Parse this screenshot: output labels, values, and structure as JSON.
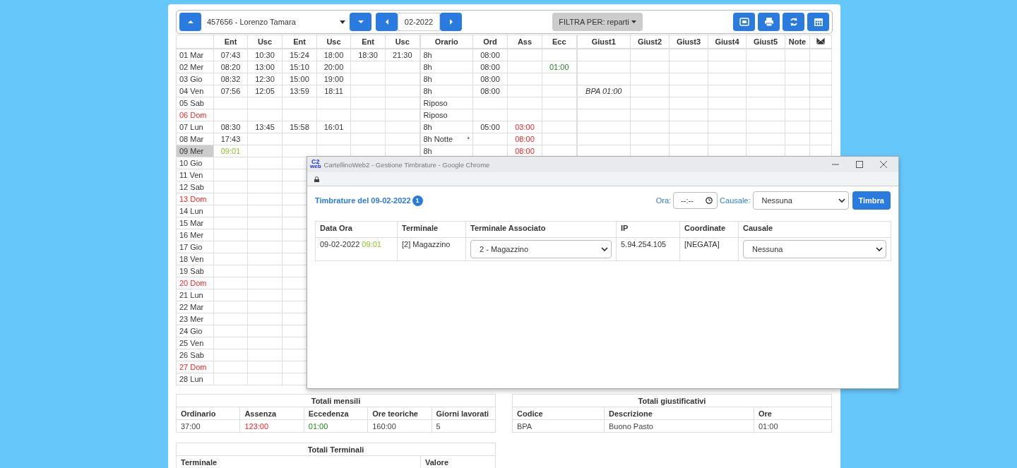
{
  "toolbar": {
    "employee": "457656 - Lorenzo Tamara",
    "period": "02-2022",
    "filter": "FILTRA PER: reparti"
  },
  "timesheet": {
    "columns": [
      "Ent",
      "Usc",
      "Ent",
      "Usc",
      "Ent",
      "Usc",
      "Orario",
      "Ord",
      "Ass",
      "Ecc",
      "Giust1",
      "Giust2",
      "Giust3",
      "Giust4",
      "Giust5",
      "Note"
    ],
    "rows": [
      {
        "day": "01 Mar",
        "holiday": false,
        "selected": false,
        "ent1": "07:43",
        "usc1": "10:30",
        "ent2": "15:24",
        "usc2": "18:00",
        "ent3": "18:30",
        "usc3": "21:30",
        "orario": "8h",
        "ord": "08:00"
      },
      {
        "day": "02 Mer",
        "holiday": false,
        "selected": false,
        "ent1": "08:20",
        "usc1": "13:00",
        "ent2": "15:10",
        "usc2": "20:00",
        "orario": "8h",
        "ord": "08:00",
        "ecc": "01:00"
      },
      {
        "day": "03 Gio",
        "holiday": false,
        "selected": false,
        "ent1": "08:32",
        "usc1": "12:30",
        "ent2": "15:00",
        "usc2": "19:00",
        "orario": "8h",
        "ord": "08:00"
      },
      {
        "day": "04 Ven",
        "holiday": false,
        "selected": false,
        "ent1": "07:56",
        "usc1": "12:05",
        "ent2": "13:59",
        "usc2": "18:11",
        "orario": "8h",
        "ord": "08:00",
        "giust1": "BPA 01:00"
      },
      {
        "day": "05 Sab",
        "holiday": false,
        "selected": false,
        "orario": "Riposo"
      },
      {
        "day": "06 Dom",
        "holiday": true,
        "selected": false,
        "orario": "Riposo"
      },
      {
        "day": "07 Lun",
        "holiday": false,
        "selected": false,
        "ent1": "08:30",
        "usc1": "13:45",
        "ent2": "15:58",
        "usc2": "16:01",
        "orario": "8h",
        "ord": "05:00",
        "ass": "03:00"
      },
      {
        "day": "08 Mar",
        "holiday": false,
        "selected": false,
        "ent1": "17:43",
        "orario": "8h Notte",
        "orario_flag": "*",
        "ass": "08:00"
      },
      {
        "day": "09 Mer",
        "holiday": false,
        "selected": true,
        "open_entry": true,
        "ent1": "09:01",
        "orario": "8h",
        "ass": "08:00"
      },
      {
        "day": "10 Gio",
        "holiday": false,
        "selected": false
      },
      {
        "day": "11 Ven",
        "holiday": false,
        "selected": false
      },
      {
        "day": "12 Sab",
        "holiday": false,
        "selected": false
      },
      {
        "day": "13 Dom",
        "holiday": true,
        "selected": false
      },
      {
        "day": "14 Lun",
        "holiday": false,
        "selected": false
      },
      {
        "day": "15 Mar",
        "holiday": false,
        "selected": false
      },
      {
        "day": "16 Mer",
        "holiday": false,
        "selected": false
      },
      {
        "day": "17 Gio",
        "holiday": false,
        "selected": false
      },
      {
        "day": "18 Ven",
        "holiday": false,
        "selected": false
      },
      {
        "day": "19 Sab",
        "holiday": false,
        "selected": false
      },
      {
        "day": "20 Dom",
        "holiday": true,
        "selected": false
      },
      {
        "day": "21 Lun",
        "holiday": false,
        "selected": false
      },
      {
        "day": "22 Mar",
        "holiday": false,
        "selected": false
      },
      {
        "day": "23 Mer",
        "holiday": false,
        "selected": false
      },
      {
        "day": "24 Gio",
        "holiday": false,
        "selected": false
      },
      {
        "day": "25 Ven",
        "holiday": false,
        "selected": false
      },
      {
        "day": "26 Sab",
        "holiday": false,
        "selected": false
      },
      {
        "day": "27 Dom",
        "holiday": true,
        "selected": false
      },
      {
        "day": "28 Lun",
        "holiday": false,
        "selected": false
      }
    ]
  },
  "monthly_totals": {
    "title": "Totali mensili",
    "columns": [
      "Ordinario",
      "Assenza",
      "Eccedenza",
      "Ore teoriche",
      "Giorni lavorati"
    ],
    "values": [
      {
        "text": "37:00"
      },
      {
        "text": "123:00",
        "color": "#ff2222"
      },
      {
        "text": "01:00",
        "color": "#1a8a1a"
      },
      {
        "text": "160:00"
      },
      {
        "text": "5"
      }
    ]
  },
  "justification_totals": {
    "title": "Totali giustificativi",
    "columns": [
      "Codice",
      "Descrizione",
      "Ore"
    ],
    "rows": [
      [
        "BPA",
        "Buono Pasto",
        "01:00"
      ]
    ]
  },
  "terminal_totals": {
    "title": "Totali Terminali",
    "columns": [
      "Terminale",
      "Valore"
    ]
  },
  "popup": {
    "logo": "C2",
    "logo_sub": "web",
    "title": "CartellinoWeb2 - Gestione Timbrature - Google Chrome",
    "heading": "Timbrature del 09-02-2022",
    "count": "1",
    "time_label": "Ora:",
    "time_placeholder": "--:--",
    "cause_label": "Causale:",
    "cause_value": "Nessuna",
    "submit": "Timbra",
    "columns": [
      "Data Ora",
      "Terminale",
      "Terminale Associato",
      "IP",
      "Coordinate",
      "Causale"
    ],
    "rows": [
      {
        "date": "09-02-2022",
        "time": "09:01",
        "terminal": "[2] Magazzino",
        "associated": "2 - Magazzino",
        "ip": "5.94.254.105",
        "coordinates": "[NEGATA]",
        "cause": "Nessuna"
      }
    ]
  }
}
